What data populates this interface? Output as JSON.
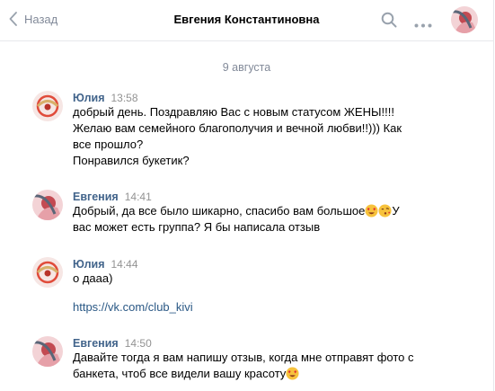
{
  "header": {
    "back_label": "Назад",
    "title": "Евгения Константиновна"
  },
  "date_divider": "9 августа",
  "messages": [
    {
      "author": "Юлия",
      "time": "13:58",
      "lines": [
        "добрый день. Поздравляю Вас с новым статусом ЖЕНЫ!!!!",
        "Желаю вам семейного благополучия и вечной любви!!))) Как",
        "все прошло?",
        "Понравился букетик?"
      ]
    },
    {
      "author": "Евгения",
      "time": "14:41",
      "line1": "Добрый, да все было шикарно, спасибо вам большое",
      "line1_tail": "У",
      "line2": "вас может есть группа? Я бы написала отзыв",
      "emojis": [
        "heart-eyes-emoji",
        "kiss-emoji"
      ]
    },
    {
      "author": "Юлия",
      "time": "14:44",
      "line1": "о дааа)",
      "link": "https://vk.com/club_kivi"
    },
    {
      "author": "Евгения",
      "time": "14:50",
      "line1": "Давайте тогда я вам напишу отзыв, когда мне отправят фото с",
      "line2": "банкета, чтоб все видели вашу красоту",
      "emojis": [
        "heart-eyes-emoji"
      ]
    }
  ],
  "colors": {
    "author": "#42648b",
    "meta": "#828a99",
    "link": "#2a5885",
    "divider": "#e7e8ec"
  },
  "icons": [
    "chevron-left-icon",
    "search-icon",
    "more-dots-icon"
  ]
}
